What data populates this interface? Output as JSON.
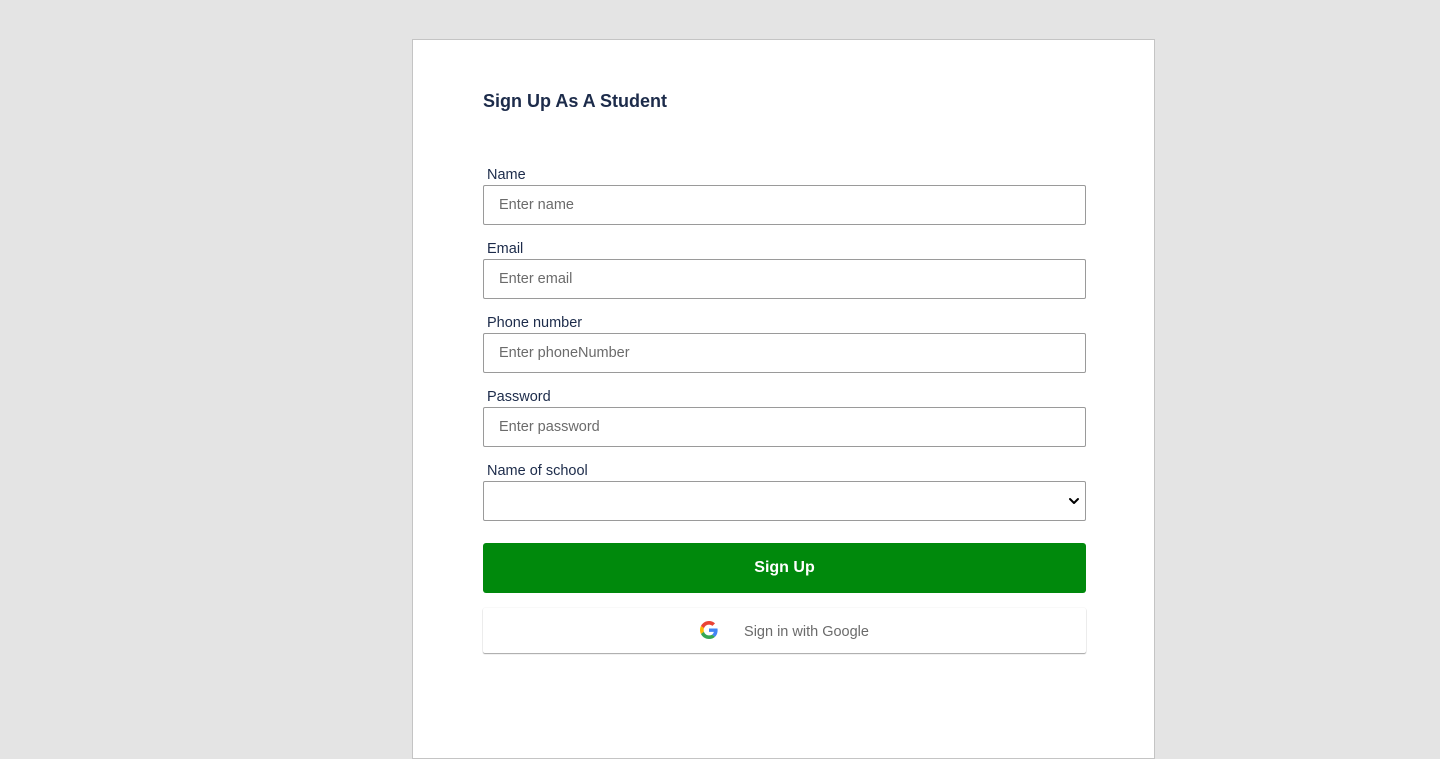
{
  "form": {
    "title": "Sign Up As A Student",
    "fields": [
      {
        "label": "Name",
        "placeholder": "Enter name",
        "value": ""
      },
      {
        "label": "Email",
        "placeholder": "Enter email",
        "value": ""
      },
      {
        "label": "Phone number",
        "placeholder": "Enter phoneNumber",
        "value": ""
      },
      {
        "label": "Password",
        "placeholder": "Enter password",
        "value": ""
      }
    ],
    "school": {
      "label": "Name of school",
      "selected": ""
    },
    "signup_label": "Sign Up",
    "google_label": "Sign in with Google"
  },
  "colors": {
    "background": "#e4e4e4",
    "card": "#ffffff",
    "title": "#1c2b4a",
    "signup_button": "#00890c"
  },
  "icons": {
    "google": "google-g-icon",
    "select_arrow": "chevron-down-icon"
  }
}
